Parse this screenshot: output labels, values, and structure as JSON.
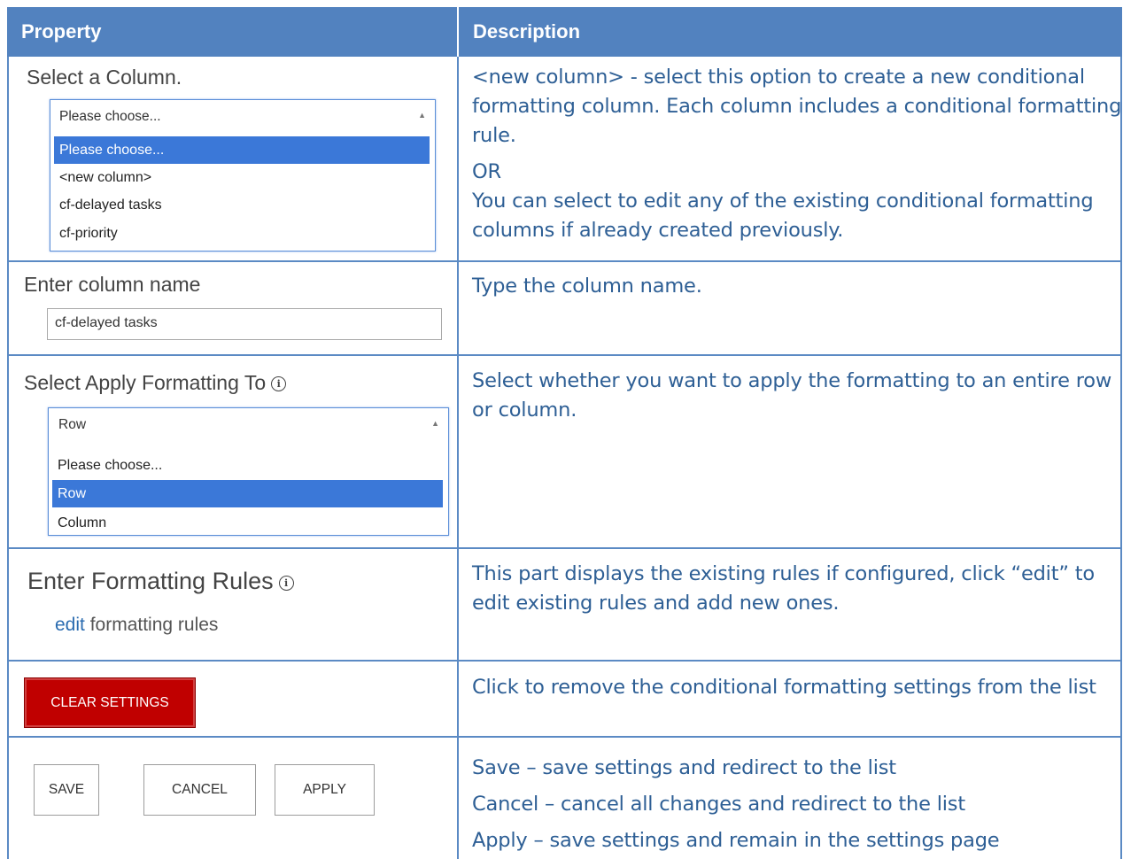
{
  "header": {
    "property": "Property",
    "description": "Description"
  },
  "row1": {
    "label": "Select a Column.",
    "select_value": "Please choose...",
    "options": [
      "Please choose...",
      "<new column>",
      "cf-delayed tasks",
      "cf-priority"
    ],
    "desc_lines": [
      "<new column> - select this option to create a new conditional",
      "formatting column. Each column includes a conditional formatting",
      "rule.",
      "OR",
      "You can select to edit any of the existing conditional formatting",
      "columns if already created previously."
    ]
  },
  "row2": {
    "label": "Enter column name",
    "input_value": "cf-delayed tasks",
    "desc": "Type the column name."
  },
  "row3": {
    "label": "Select Apply Formatting To",
    "info_icon": "ⓘ",
    "select_value": "Row",
    "options": [
      "Please choose...",
      "Row",
      "Column"
    ],
    "desc_lines": [
      "Select whether you want to apply the formatting to an entire row",
      "or column."
    ]
  },
  "row4": {
    "label": "Enter Formatting Rules",
    "info_icon": "ⓘ",
    "edit_link": "edit",
    "edit_suffix": "formatting rules",
    "desc_lines": [
      "This part displays the existing rules if configured, click “edit” to",
      "edit existing rules and add new ones."
    ]
  },
  "row5": {
    "button": "CLEAR SETTINGS",
    "desc": "Click to remove the conditional formatting settings from the list"
  },
  "row6": {
    "save": "SAVE",
    "cancel": "CANCEL",
    "apply": "APPLY",
    "desc_lines": [
      "Save – save settings and redirect to the list",
      "Cancel – cancel all changes and redirect to the list",
      "Apply – save settings and remain in the settings page"
    ]
  },
  "colors": {
    "header_bg": "#5282bf",
    "description_text": "#2e5f95",
    "selected_option": "#3b78d8",
    "clear_button": "#c00000",
    "link": "#2b6cb0"
  }
}
